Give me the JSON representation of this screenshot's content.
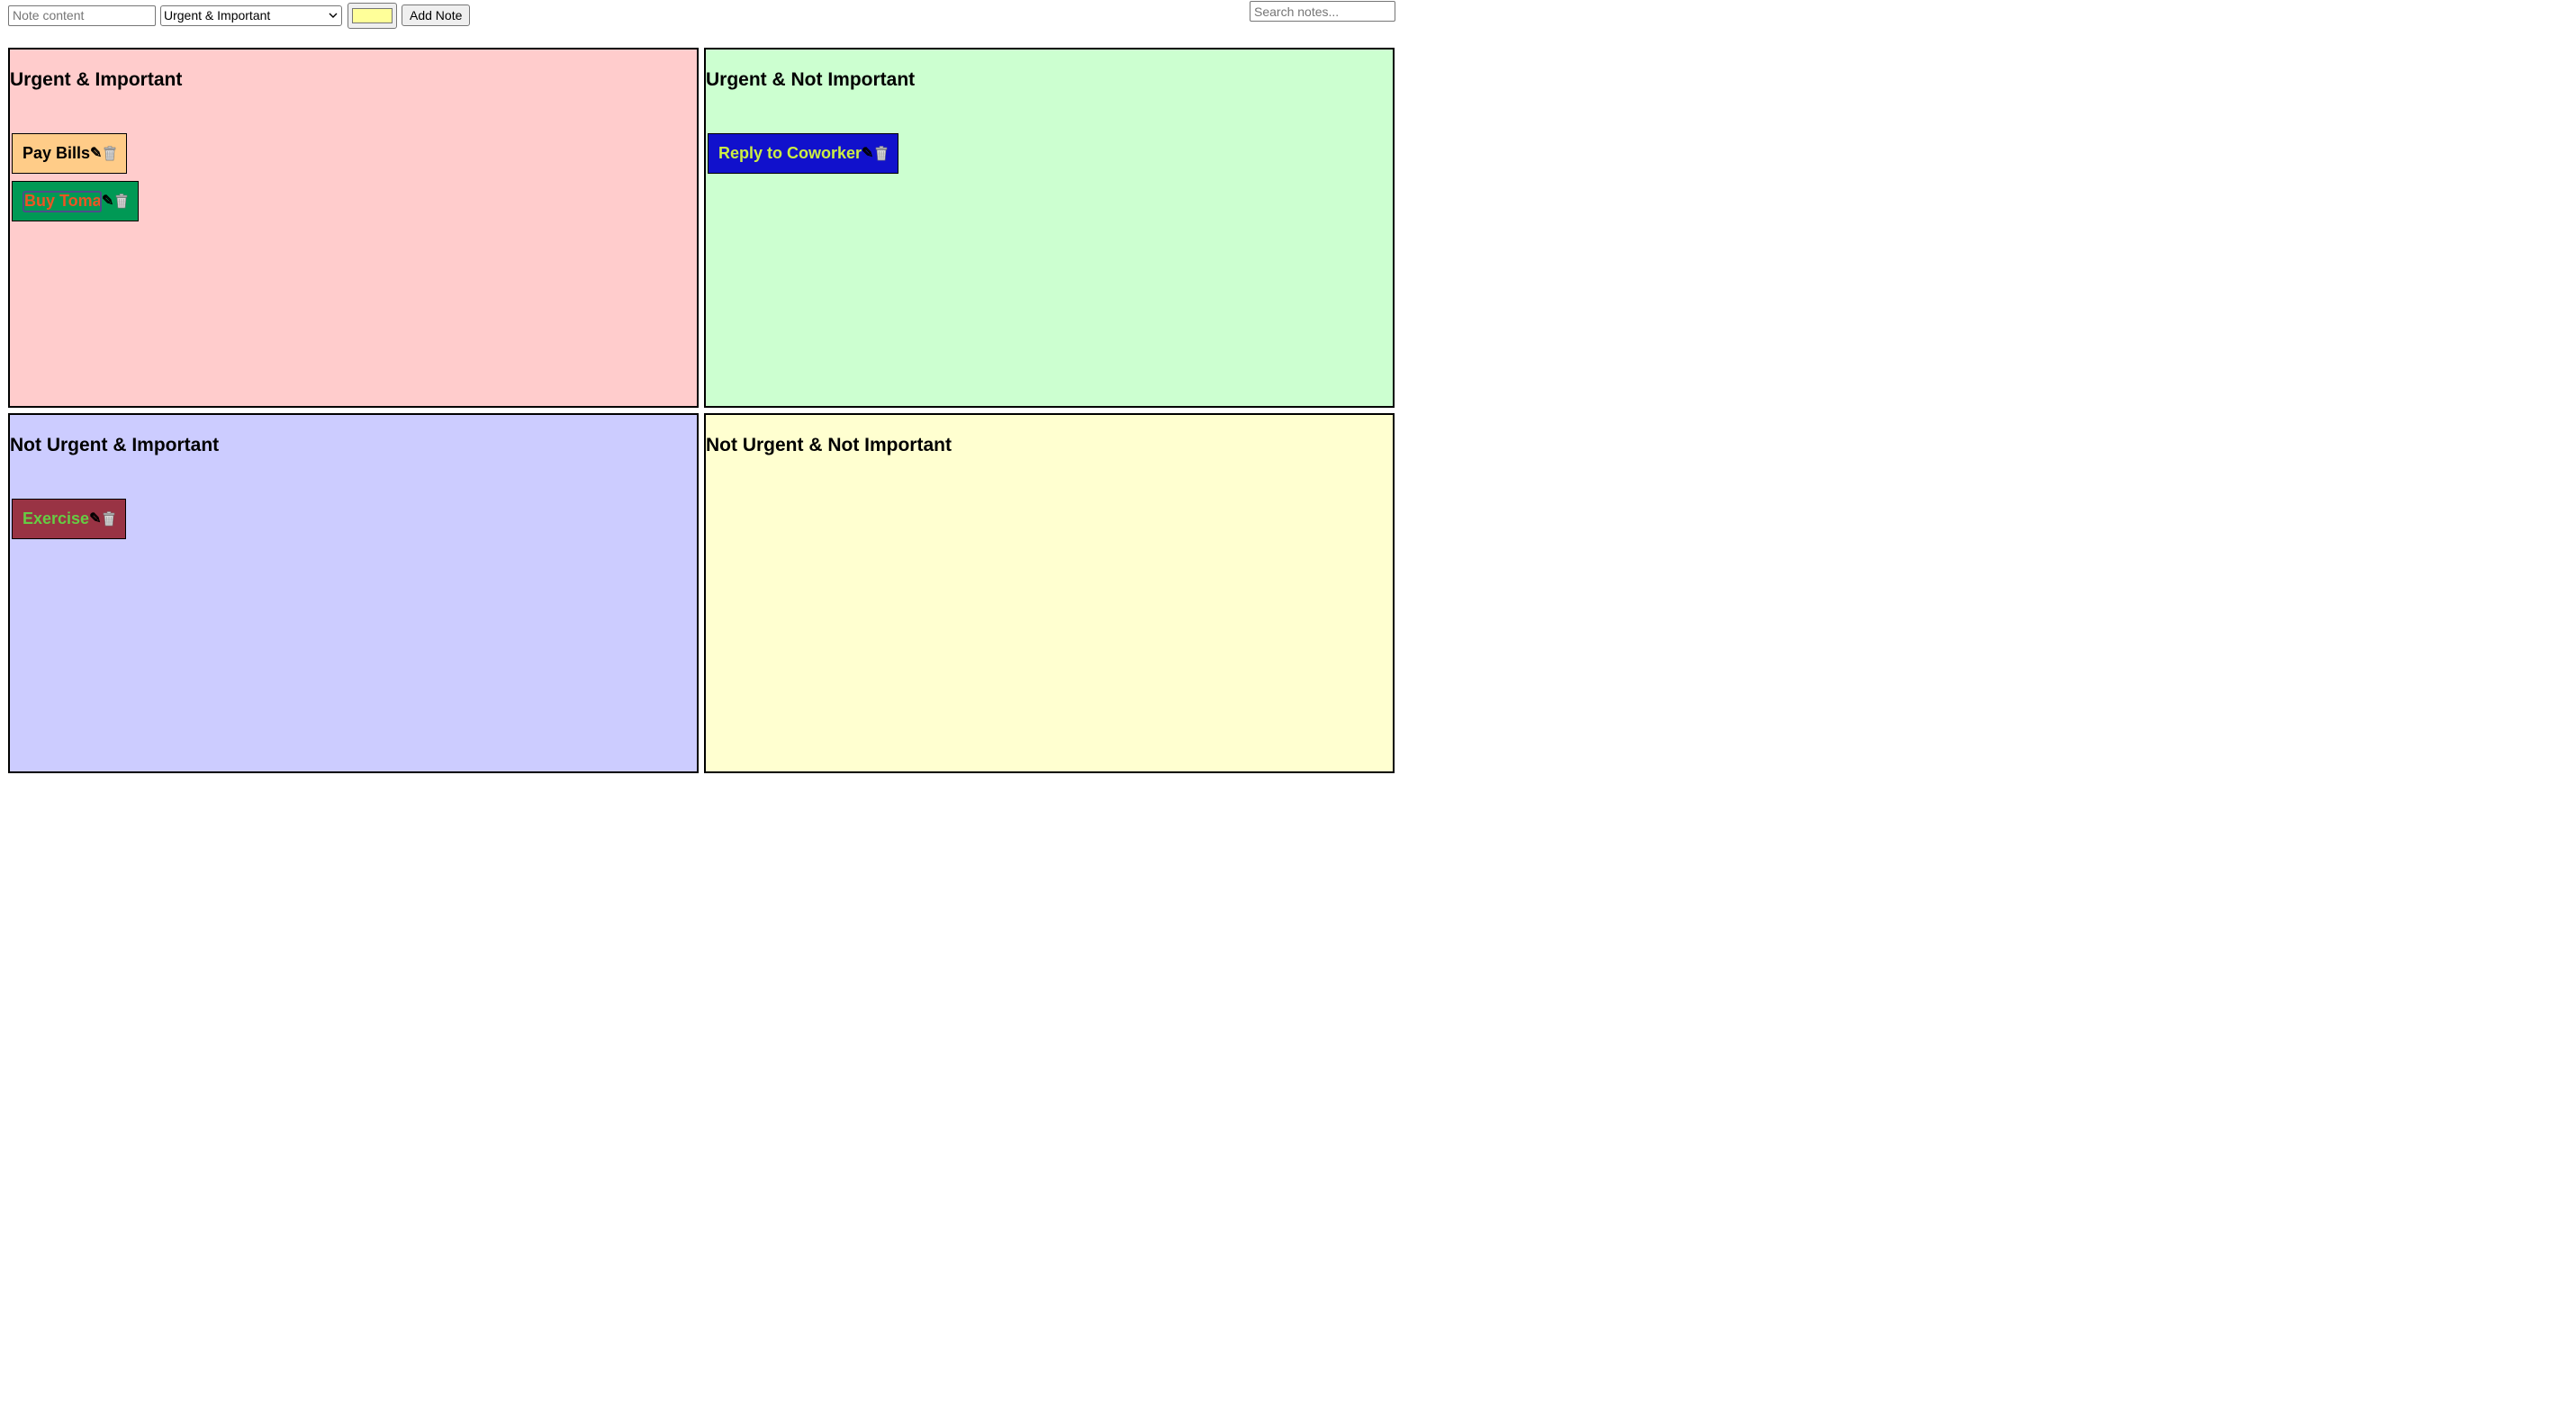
{
  "toolbar": {
    "note_placeholder": "Note content",
    "quadrant_selected": "Urgent & Important",
    "color_value": "#ffff99",
    "add_label": "Add Note"
  },
  "search": {
    "placeholder": "Search notes..."
  },
  "quadrants": [
    {
      "title": "Urgent & Important",
      "bg": "#ffcccc",
      "notes": [
        {
          "text": "Pay Bills",
          "bg": "#ffcc88",
          "color": "#000000",
          "editing": false
        },
        {
          "text": "Buy Tomatoes",
          "bg": "#009955",
          "color": "#ee5522",
          "editing": true
        }
      ]
    },
    {
      "title": "Urgent & Not Important",
      "bg": "#ccffd0",
      "notes": [
        {
          "text": "Reply to Coworker",
          "bg": "#1111cc",
          "color": "#ccee44",
          "editing": false
        }
      ]
    },
    {
      "title": "Not Urgent & Important",
      "bg": "#ccccff",
      "notes": [
        {
          "text": "Exercise",
          "bg": "#993344",
          "color": "#66cc44",
          "editing": false
        }
      ]
    },
    {
      "title": "Not Urgent & Not Important",
      "bg": "#ffffd0",
      "notes": []
    }
  ],
  "icons": {
    "edit": "pencil-icon",
    "delete": "trash-icon"
  }
}
